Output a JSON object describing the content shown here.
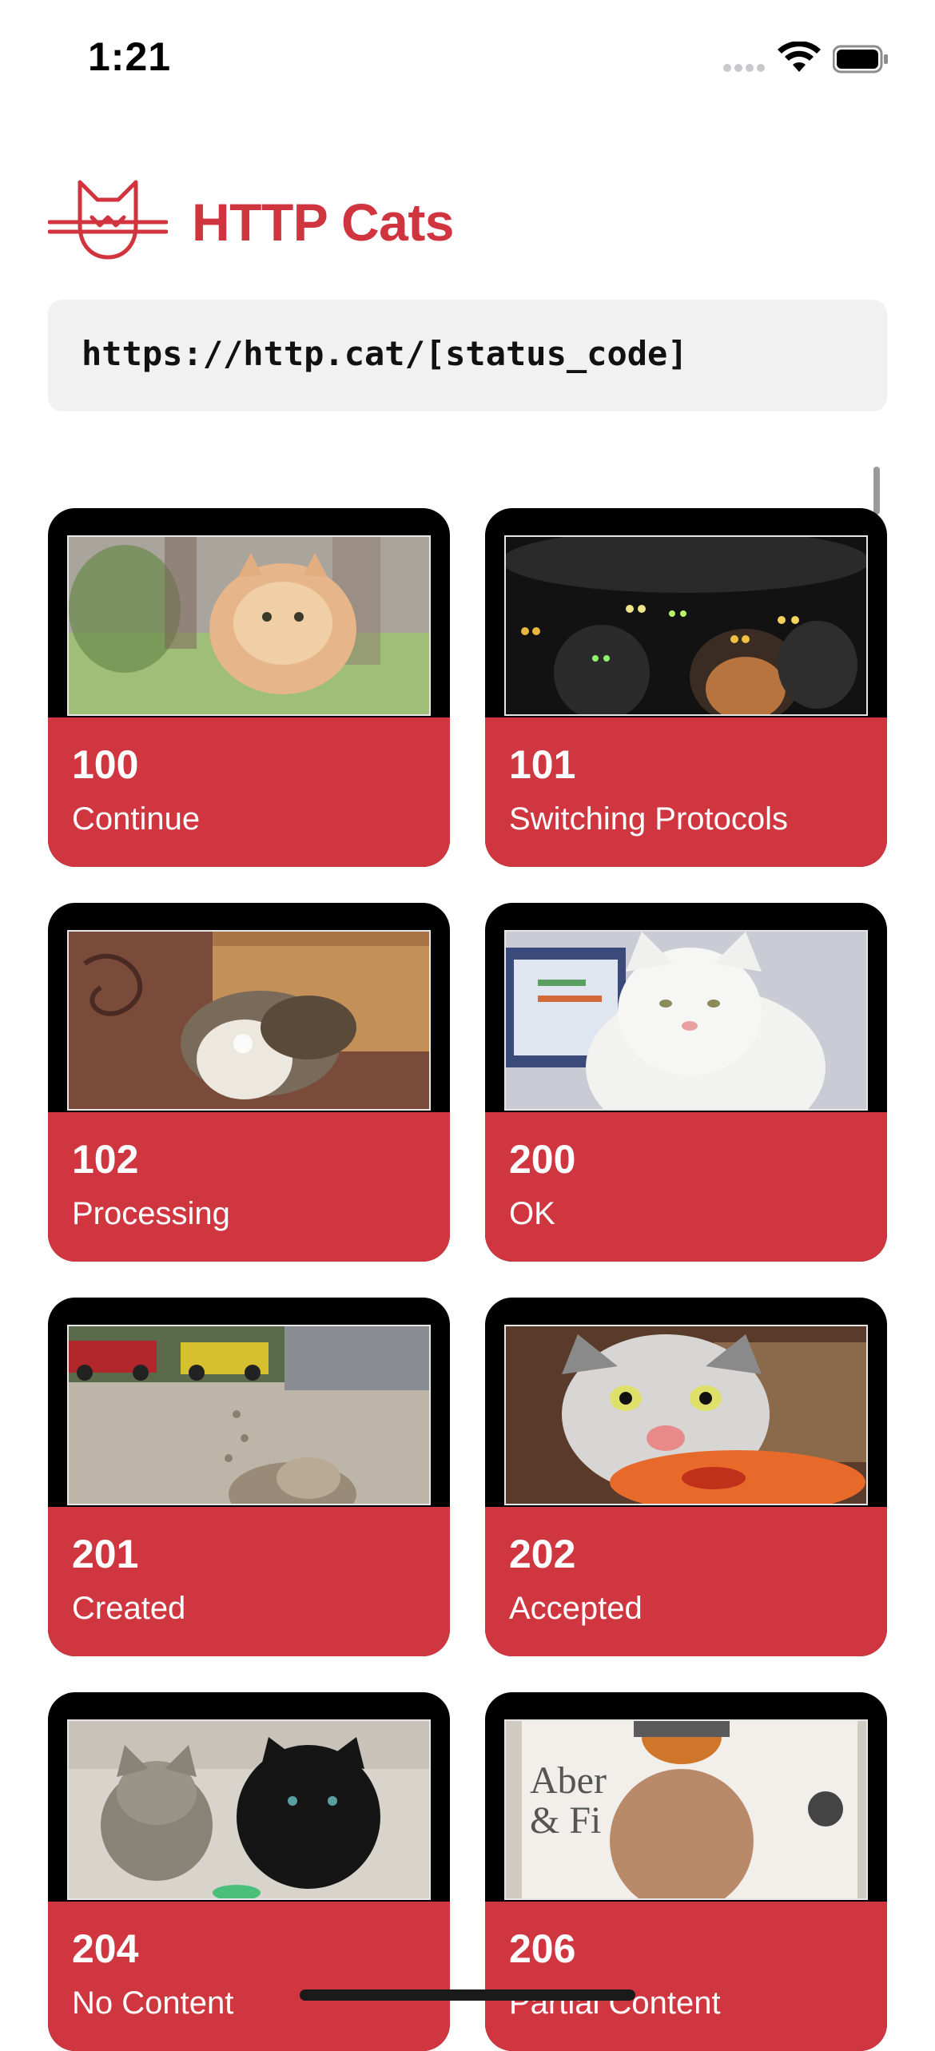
{
  "status_bar": {
    "time": "1:21"
  },
  "header": {
    "title": "HTTP Cats",
    "logo_icon": "cat-logo-icon",
    "brand_color": "#d0343e"
  },
  "url_template": "https://http.cat/[status_code]",
  "cards": [
    {
      "code": "100",
      "text": "Continue"
    },
    {
      "code": "101",
      "text": "Switching Protocols"
    },
    {
      "code": "102",
      "text": "Processing"
    },
    {
      "code": "200",
      "text": "OK"
    },
    {
      "code": "201",
      "text": "Created"
    },
    {
      "code": "202",
      "text": "Accepted"
    },
    {
      "code": "204",
      "text": "No Content"
    },
    {
      "code": "206",
      "text": "Partial Content"
    }
  ]
}
